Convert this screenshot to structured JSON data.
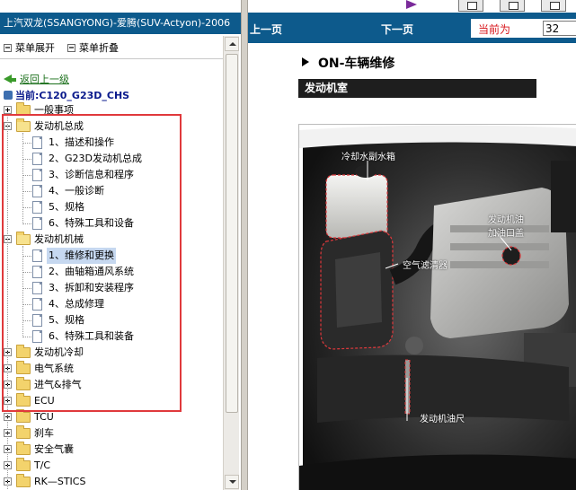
{
  "window_title": "上汽双龙(SSANGYONG)-爱腾(SUV-Actyon)-2006",
  "menu": {
    "expand_label": "菜单展开",
    "collapse_label": "菜单折叠"
  },
  "back_link": "返回上一级",
  "current_label": "当前:C120_G23D_CHS",
  "tree": [
    {
      "label": "一般事项",
      "kind": "folder",
      "expanded": false
    },
    {
      "label": "发动机总成",
      "kind": "folder",
      "expanded": true
    },
    {
      "label": "1、描述和操作",
      "kind": "doc"
    },
    {
      "label": "2、G23D发动机总成",
      "kind": "doc"
    },
    {
      "label": "3、诊断信息和程序",
      "kind": "doc"
    },
    {
      "label": "4、一般诊断",
      "kind": "doc"
    },
    {
      "label": "5、规格",
      "kind": "doc"
    },
    {
      "label": "6、特殊工具和设备",
      "kind": "doc"
    },
    {
      "label": "发动机机械",
      "kind": "folder",
      "expanded": true
    },
    {
      "label": "1、维修和更换",
      "kind": "doc",
      "selected": true
    },
    {
      "label": "2、曲轴箱通风系统",
      "kind": "doc"
    },
    {
      "label": "3、拆卸和安装程序",
      "kind": "doc"
    },
    {
      "label": "4、总成修理",
      "kind": "doc"
    },
    {
      "label": "5、规格",
      "kind": "doc"
    },
    {
      "label": "6、特殊工具和装备",
      "kind": "doc"
    },
    {
      "label": "发动机冷却",
      "kind": "folder",
      "expanded": false
    },
    {
      "label": "电气系统",
      "kind": "folder",
      "expanded": false
    },
    {
      "label": "进气&排气",
      "kind": "folder",
      "expanded": false
    },
    {
      "label": "ECU",
      "kind": "folder",
      "expanded": false
    },
    {
      "label": "TCU",
      "kind": "folder",
      "expanded": false
    },
    {
      "label": "刹车",
      "kind": "folder",
      "expanded": false
    },
    {
      "label": "安全气囊",
      "kind": "folder",
      "expanded": false
    },
    {
      "label": "T/C",
      "kind": "folder",
      "expanded": false
    },
    {
      "label": "RK—STICS",
      "kind": "folder",
      "expanded": false
    }
  ],
  "nav": {
    "prev_label": "上一页",
    "next_label": "下一页",
    "current_page_label": "当前为",
    "current_page_value": "32"
  },
  "doc": {
    "heading": "ON-车辆维修",
    "section_title": "发动机室",
    "callouts": {
      "coolant_tank": "冷却水副水箱",
      "oil_filler_line1": "发动机油",
      "oil_filler_line2": "加油口盖",
      "air_cleaner": "空气滤清器",
      "dipstick": "发动机油尺"
    }
  },
  "colors": {
    "header_blue": "#0d5a8c",
    "highlight_red": "#e0393c",
    "page_label_red": "#d8161b"
  }
}
